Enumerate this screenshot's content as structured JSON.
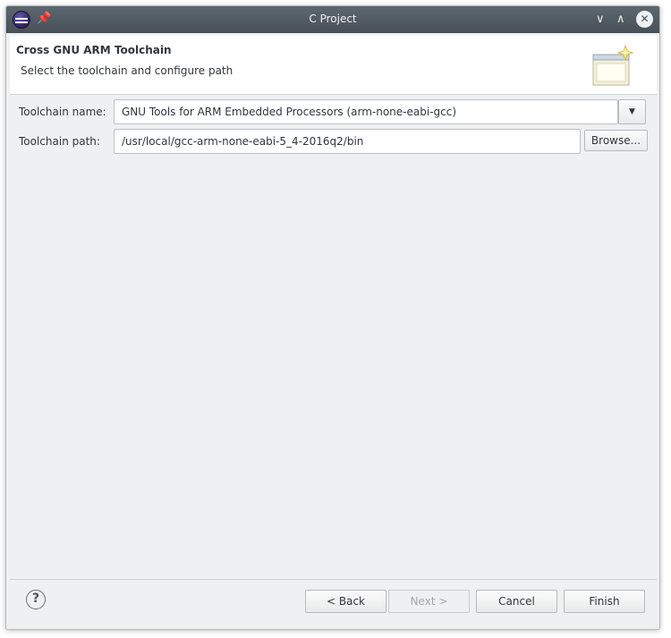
{
  "window": {
    "title": "C Project",
    "icons": {
      "app": "eclipse-icon",
      "pin": "pin-icon",
      "minimize": "chevron-down-icon",
      "maximize": "chevron-up-icon",
      "close": "close-icon"
    },
    "glyphs": {
      "pin": "📌",
      "minimize": "∨",
      "maximize": "∧",
      "close": "✕"
    }
  },
  "banner": {
    "heading": "Cross GNU ARM Toolchain",
    "subtitle": "Select the toolchain and configure path",
    "icon": "wizard-banner-icon"
  },
  "form": {
    "toolchain_name_label": "Toolchain name:",
    "toolchain_name_value": "GNU Tools for ARM Embedded Processors (arm-none-eabi-gcc)",
    "dropdown_glyph": "▼",
    "toolchain_path_label": "Toolchain path:",
    "toolchain_path_value": "/usr/local/gcc-arm-none-eabi-5_4-2016q2/bin",
    "browse_label": "Browse..."
  },
  "footer": {
    "help_glyph": "?",
    "back_label": "< Back",
    "next_label": "Next >",
    "cancel_label": "Cancel",
    "finish_label": "Finish"
  },
  "colors": {
    "window_bg": "#eff0f1",
    "titlebar": "#475057",
    "text": "#31363b",
    "disabled_text": "#a5a8ab"
  }
}
